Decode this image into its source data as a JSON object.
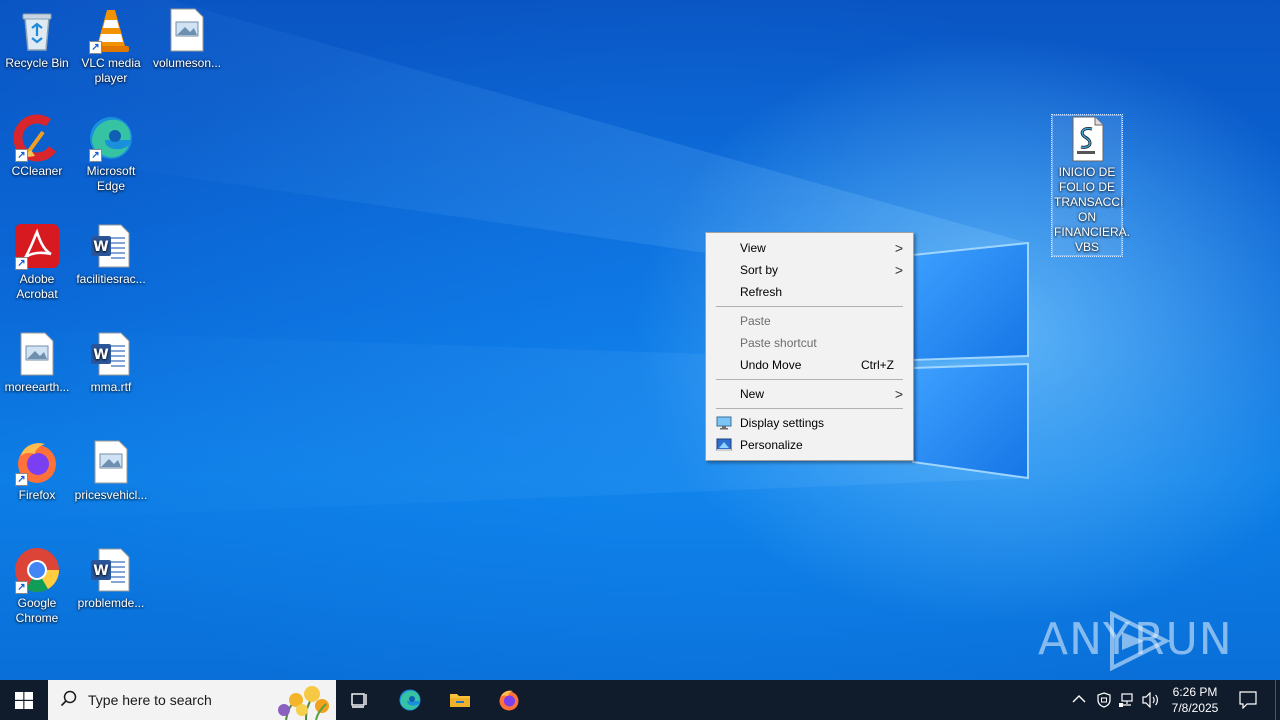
{
  "desktop_icons": [
    {
      "name": "recycle-bin",
      "label": "Recycle Bin"
    },
    {
      "name": "vlc-media-player",
      "label": "VLC media player"
    },
    {
      "name": "volumeson-file",
      "label": "volumeson..."
    },
    {
      "name": "ccleaner",
      "label": "CCleaner"
    },
    {
      "name": "microsoft-edge",
      "label": "Microsoft Edge"
    },
    {
      "name": "adobe-acrobat",
      "label": "Adobe Acrobat"
    },
    {
      "name": "facilitiesrac-doc",
      "label": "facilitiesrac..."
    },
    {
      "name": "moreearth-file",
      "label": "moreearth..."
    },
    {
      "name": "mma-rtf",
      "label": "mma.rtf"
    },
    {
      "name": "firefox",
      "label": "Firefox"
    },
    {
      "name": "pricesvehicl-file",
      "label": "pricesvehicl..."
    },
    {
      "name": "google-chrome",
      "label": "Google Chrome"
    },
    {
      "name": "problemde-doc",
      "label": "problemde..."
    },
    {
      "name": "vbs-script",
      "label": "INICIO DE FOLIO DE TRANSACCI ON FINANCIERA. VBS"
    }
  ],
  "context_menu": {
    "view": "View",
    "sort_by": "Sort by",
    "refresh": "Refresh",
    "paste": "Paste",
    "paste_shortcut": "Paste shortcut",
    "undo_move": "Undo Move",
    "undo_move_shortcut": "Ctrl+Z",
    "new": "New",
    "display_settings": "Display settings",
    "personalize": "Personalize"
  },
  "watermark": {
    "left": "ANY",
    "right": "RUN"
  },
  "taskbar": {
    "search_placeholder": "Type here to search",
    "clock_time": "6:26 PM",
    "clock_date": "7/8/2025",
    "pinned": [
      "task-view",
      "microsoft-edge",
      "file-explorer",
      "firefox"
    ]
  },
  "colors": {
    "taskbar_bg": "#101b2c",
    "menu_bg": "#f2f2f2",
    "desktop_accent": "#0a63c9"
  }
}
